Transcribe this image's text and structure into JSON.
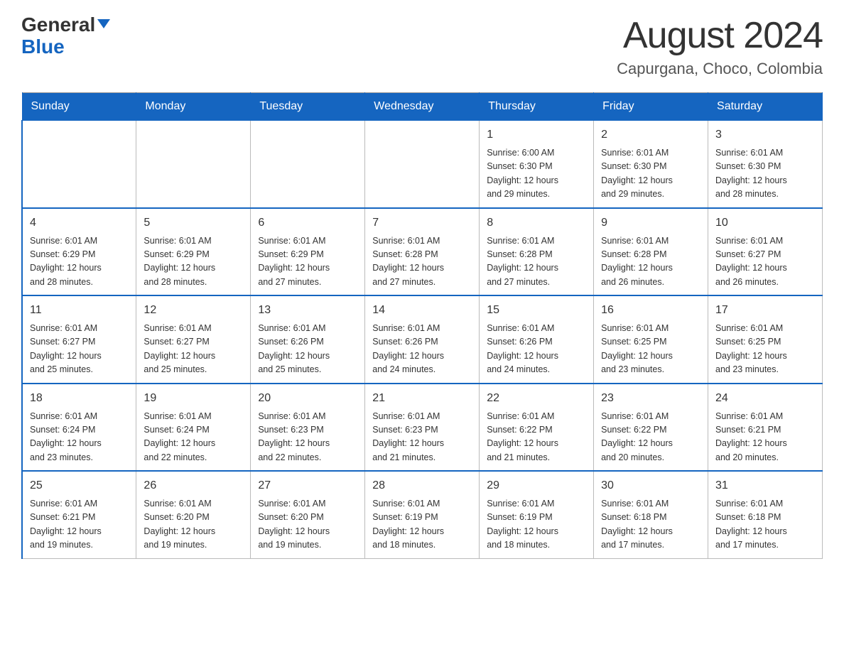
{
  "header": {
    "logo_text_black": "General",
    "logo_text_blue": "Blue",
    "month_title": "August 2024",
    "location": "Capurgana, Choco, Colombia"
  },
  "weekdays": [
    "Sunday",
    "Monday",
    "Tuesday",
    "Wednesday",
    "Thursday",
    "Friday",
    "Saturday"
  ],
  "weeks": [
    [
      {
        "day": "",
        "info": ""
      },
      {
        "day": "",
        "info": ""
      },
      {
        "day": "",
        "info": ""
      },
      {
        "day": "",
        "info": ""
      },
      {
        "day": "1",
        "info": "Sunrise: 6:00 AM\nSunset: 6:30 PM\nDaylight: 12 hours\nand 29 minutes."
      },
      {
        "day": "2",
        "info": "Sunrise: 6:01 AM\nSunset: 6:30 PM\nDaylight: 12 hours\nand 29 minutes."
      },
      {
        "day": "3",
        "info": "Sunrise: 6:01 AM\nSunset: 6:30 PM\nDaylight: 12 hours\nand 28 minutes."
      }
    ],
    [
      {
        "day": "4",
        "info": "Sunrise: 6:01 AM\nSunset: 6:29 PM\nDaylight: 12 hours\nand 28 minutes."
      },
      {
        "day": "5",
        "info": "Sunrise: 6:01 AM\nSunset: 6:29 PM\nDaylight: 12 hours\nand 28 minutes."
      },
      {
        "day": "6",
        "info": "Sunrise: 6:01 AM\nSunset: 6:29 PM\nDaylight: 12 hours\nand 27 minutes."
      },
      {
        "day": "7",
        "info": "Sunrise: 6:01 AM\nSunset: 6:28 PM\nDaylight: 12 hours\nand 27 minutes."
      },
      {
        "day": "8",
        "info": "Sunrise: 6:01 AM\nSunset: 6:28 PM\nDaylight: 12 hours\nand 27 minutes."
      },
      {
        "day": "9",
        "info": "Sunrise: 6:01 AM\nSunset: 6:28 PM\nDaylight: 12 hours\nand 26 minutes."
      },
      {
        "day": "10",
        "info": "Sunrise: 6:01 AM\nSunset: 6:27 PM\nDaylight: 12 hours\nand 26 minutes."
      }
    ],
    [
      {
        "day": "11",
        "info": "Sunrise: 6:01 AM\nSunset: 6:27 PM\nDaylight: 12 hours\nand 25 minutes."
      },
      {
        "day": "12",
        "info": "Sunrise: 6:01 AM\nSunset: 6:27 PM\nDaylight: 12 hours\nand 25 minutes."
      },
      {
        "day": "13",
        "info": "Sunrise: 6:01 AM\nSunset: 6:26 PM\nDaylight: 12 hours\nand 25 minutes."
      },
      {
        "day": "14",
        "info": "Sunrise: 6:01 AM\nSunset: 6:26 PM\nDaylight: 12 hours\nand 24 minutes."
      },
      {
        "day": "15",
        "info": "Sunrise: 6:01 AM\nSunset: 6:26 PM\nDaylight: 12 hours\nand 24 minutes."
      },
      {
        "day": "16",
        "info": "Sunrise: 6:01 AM\nSunset: 6:25 PM\nDaylight: 12 hours\nand 23 minutes."
      },
      {
        "day": "17",
        "info": "Sunrise: 6:01 AM\nSunset: 6:25 PM\nDaylight: 12 hours\nand 23 minutes."
      }
    ],
    [
      {
        "day": "18",
        "info": "Sunrise: 6:01 AM\nSunset: 6:24 PM\nDaylight: 12 hours\nand 23 minutes."
      },
      {
        "day": "19",
        "info": "Sunrise: 6:01 AM\nSunset: 6:24 PM\nDaylight: 12 hours\nand 22 minutes."
      },
      {
        "day": "20",
        "info": "Sunrise: 6:01 AM\nSunset: 6:23 PM\nDaylight: 12 hours\nand 22 minutes."
      },
      {
        "day": "21",
        "info": "Sunrise: 6:01 AM\nSunset: 6:23 PM\nDaylight: 12 hours\nand 21 minutes."
      },
      {
        "day": "22",
        "info": "Sunrise: 6:01 AM\nSunset: 6:22 PM\nDaylight: 12 hours\nand 21 minutes."
      },
      {
        "day": "23",
        "info": "Sunrise: 6:01 AM\nSunset: 6:22 PM\nDaylight: 12 hours\nand 20 minutes."
      },
      {
        "day": "24",
        "info": "Sunrise: 6:01 AM\nSunset: 6:21 PM\nDaylight: 12 hours\nand 20 minutes."
      }
    ],
    [
      {
        "day": "25",
        "info": "Sunrise: 6:01 AM\nSunset: 6:21 PM\nDaylight: 12 hours\nand 19 minutes."
      },
      {
        "day": "26",
        "info": "Sunrise: 6:01 AM\nSunset: 6:20 PM\nDaylight: 12 hours\nand 19 minutes."
      },
      {
        "day": "27",
        "info": "Sunrise: 6:01 AM\nSunset: 6:20 PM\nDaylight: 12 hours\nand 19 minutes."
      },
      {
        "day": "28",
        "info": "Sunrise: 6:01 AM\nSunset: 6:19 PM\nDaylight: 12 hours\nand 18 minutes."
      },
      {
        "day": "29",
        "info": "Sunrise: 6:01 AM\nSunset: 6:19 PM\nDaylight: 12 hours\nand 18 minutes."
      },
      {
        "day": "30",
        "info": "Sunrise: 6:01 AM\nSunset: 6:18 PM\nDaylight: 12 hours\nand 17 minutes."
      },
      {
        "day": "31",
        "info": "Sunrise: 6:01 AM\nSunset: 6:18 PM\nDaylight: 12 hours\nand 17 minutes."
      }
    ]
  ]
}
